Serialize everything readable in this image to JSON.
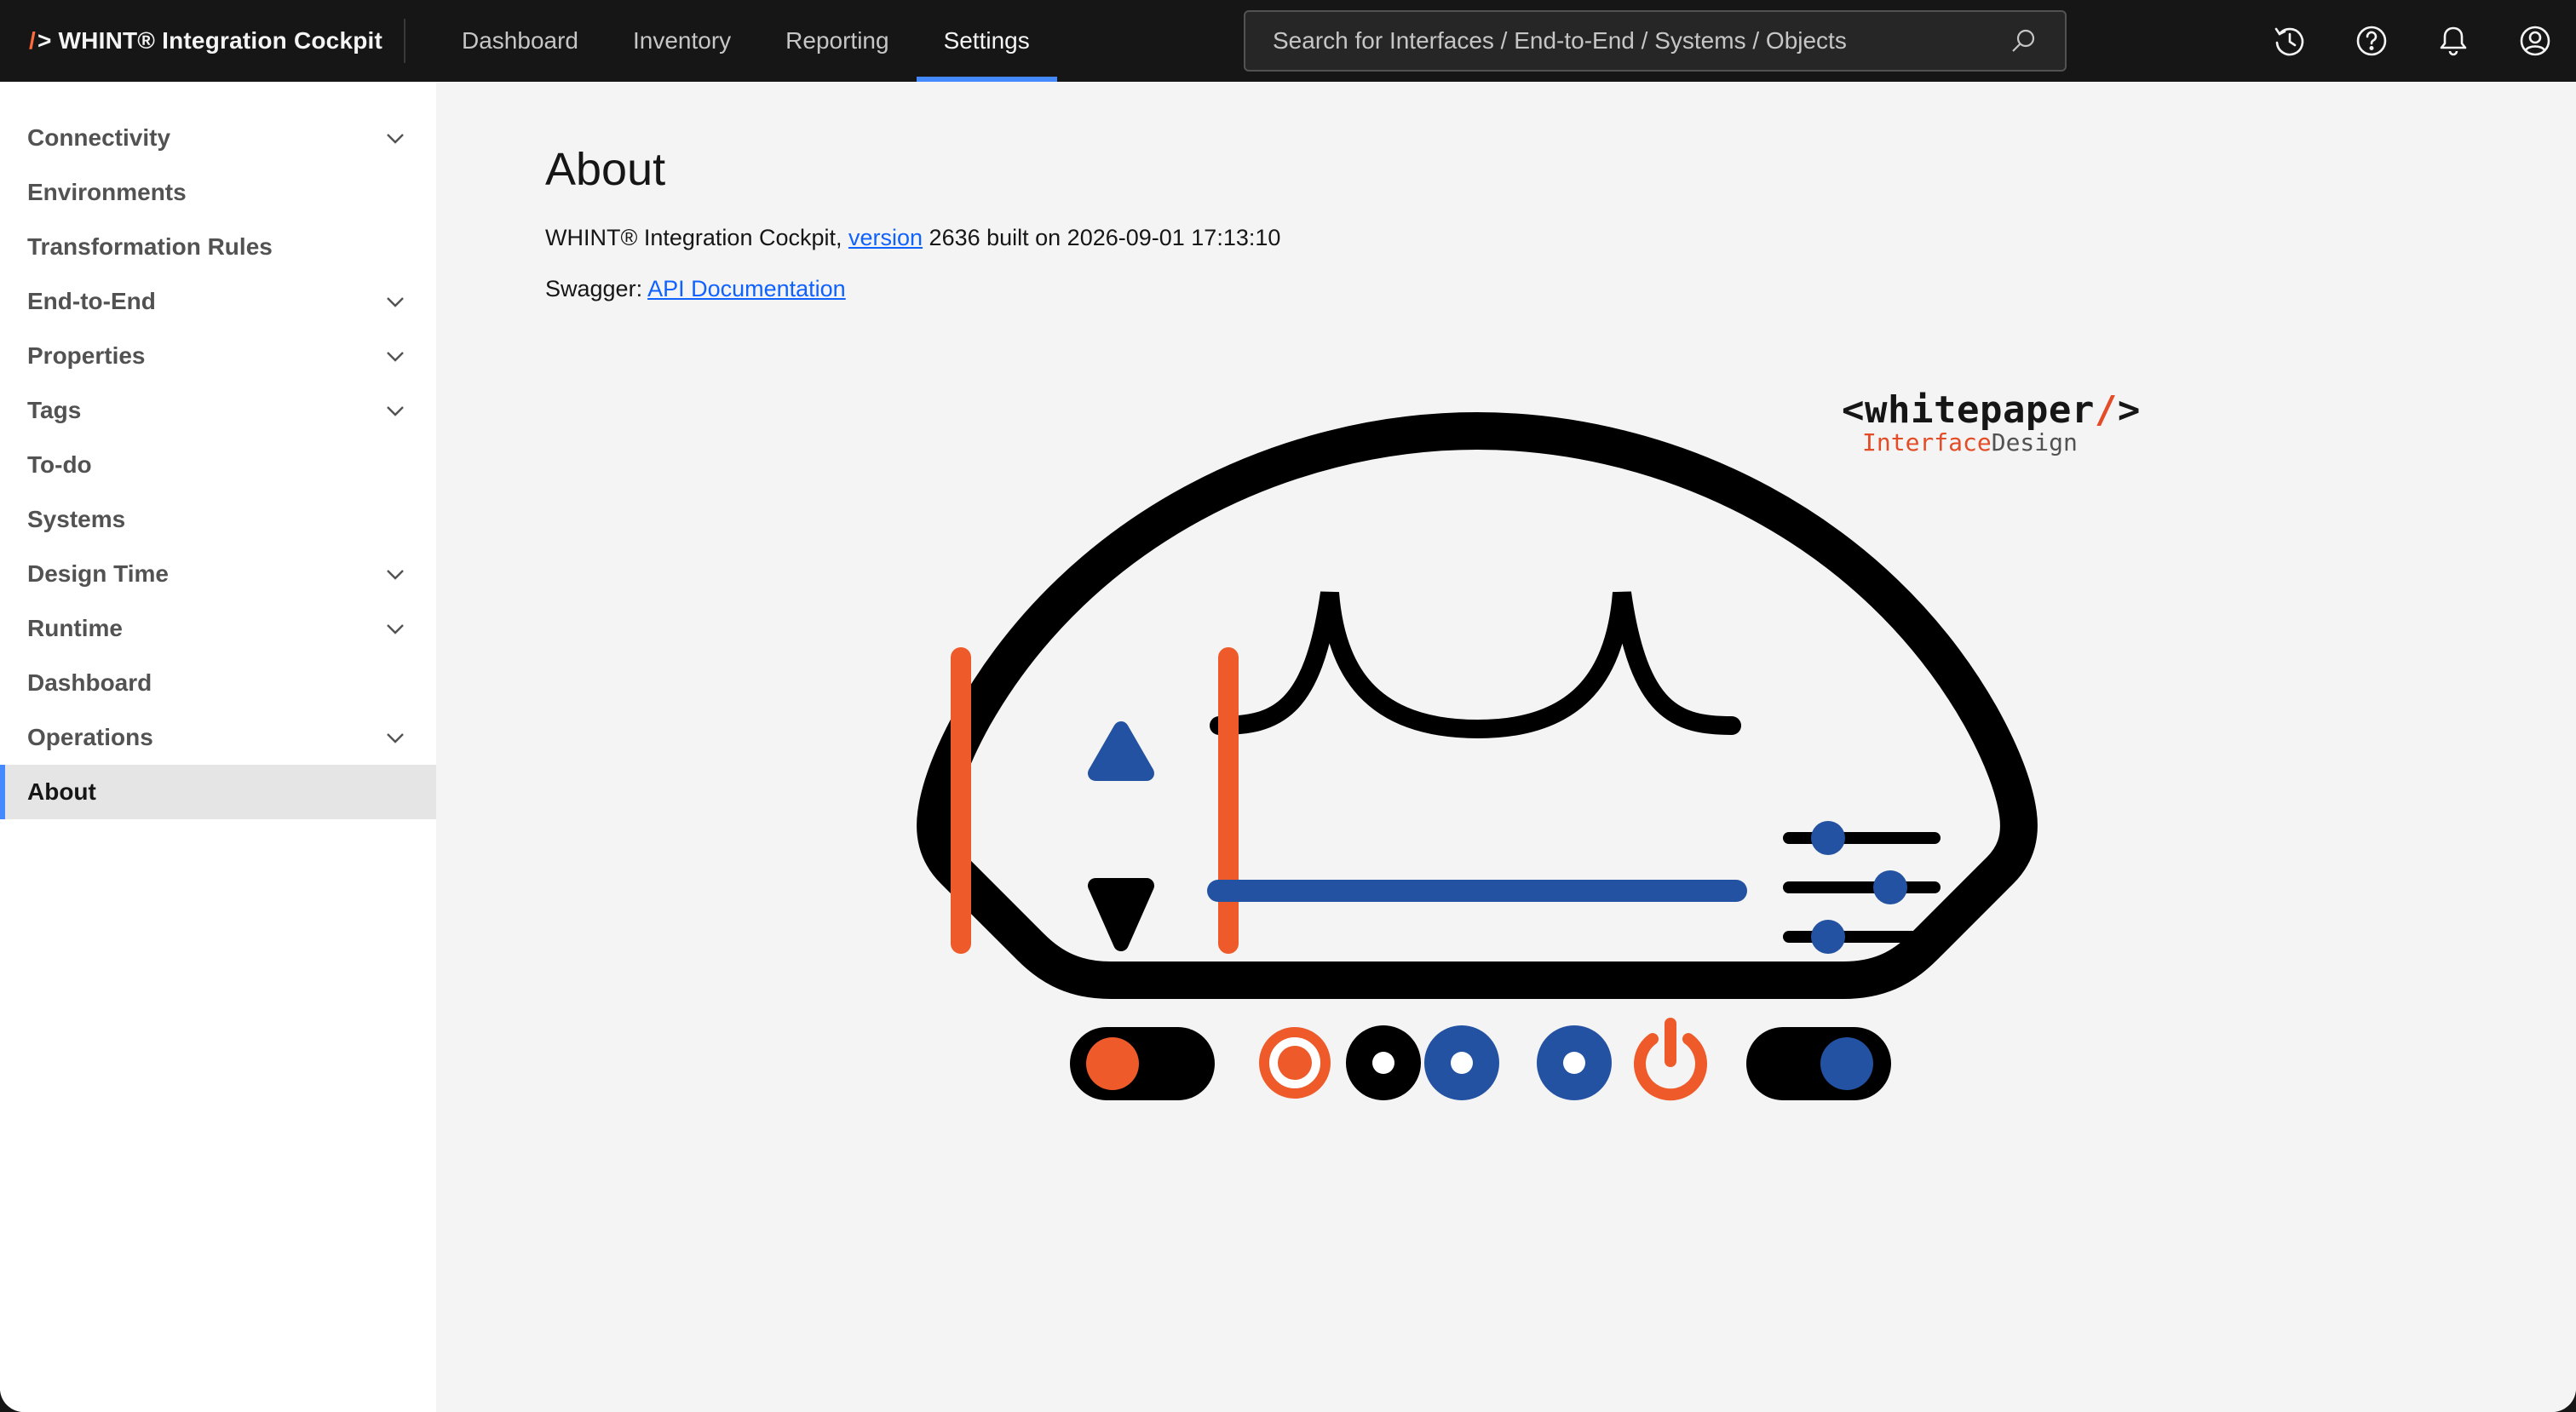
{
  "header": {
    "brand_prefix": "/>",
    "brand_name": "WHINT® Integration Cockpit",
    "nav": [
      {
        "label": "Dashboard",
        "active": false
      },
      {
        "label": "Inventory",
        "active": false
      },
      {
        "label": "Reporting",
        "active": false
      },
      {
        "label": "Settings",
        "active": true
      }
    ],
    "search_placeholder": "Search for Interfaces / End-to-End / Systems / Objects",
    "icons": [
      "history-icon",
      "help-icon",
      "notification-icon",
      "user-profile-icon"
    ]
  },
  "sidebar": {
    "items": [
      {
        "label": "Connectivity",
        "expandable": true
      },
      {
        "label": "Environments",
        "expandable": false
      },
      {
        "label": "Transformation Rules",
        "expandable": false
      },
      {
        "label": "End-to-End",
        "expandable": true
      },
      {
        "label": "Properties",
        "expandable": true
      },
      {
        "label": "Tags",
        "expandable": true
      },
      {
        "label": "To-do",
        "expandable": false
      },
      {
        "label": "Systems",
        "expandable": false
      },
      {
        "label": "Design Time",
        "expandable": true
      },
      {
        "label": "Runtime",
        "expandable": true
      },
      {
        "label": "Dashboard",
        "expandable": false
      },
      {
        "label": "Operations",
        "expandable": true
      },
      {
        "label": "About",
        "expandable": false,
        "active": true
      }
    ]
  },
  "main": {
    "title": "About",
    "product_prefix": "WHINT® Integration Cockpit, ",
    "version_link": "version",
    "build_text": " 2636 built on 2026-09-01 17:13:10",
    "swagger_label": "Swagger: ",
    "swagger_link": "API Documentation",
    "logo": {
      "open": "<",
      "word": "whitepaper",
      "slash": "/",
      "close": ">",
      "sub_a": "Interface",
      "sub_b": "Design"
    }
  },
  "colors": {
    "accent_blue": "#4589ff",
    "brand_orange": "#ee5a2a",
    "logo_blue": "#2352a3",
    "header_bg": "#161616"
  }
}
